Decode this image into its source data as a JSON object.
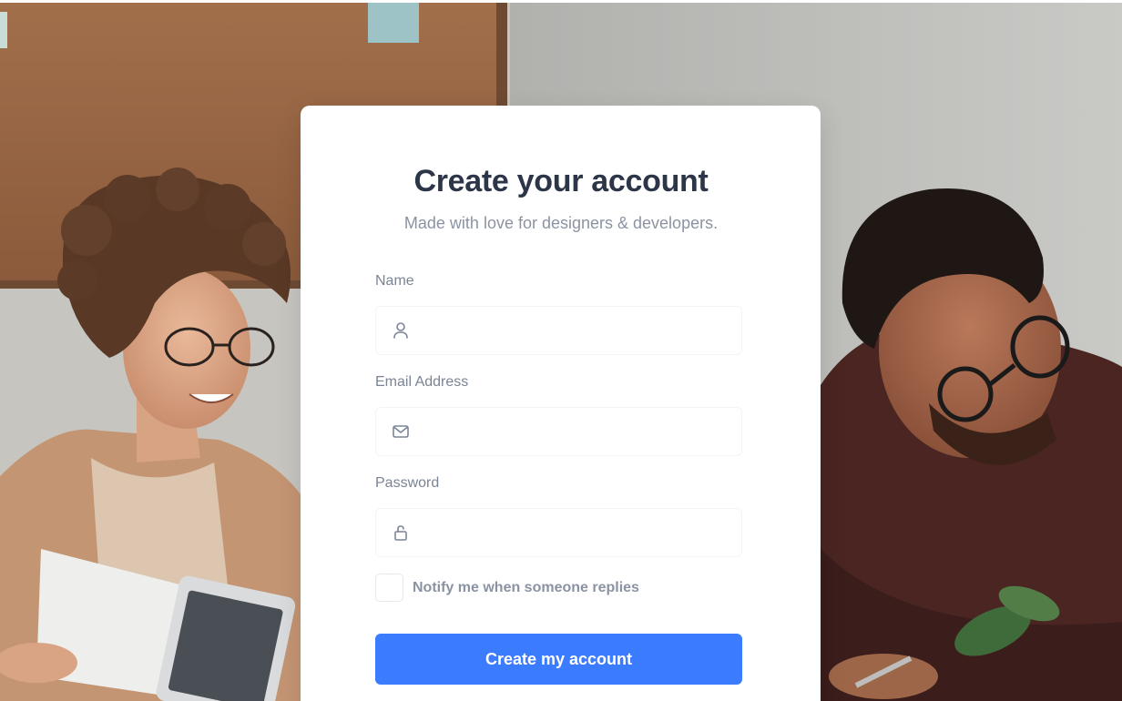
{
  "form": {
    "title": "Create your account",
    "subtitle": "Made with love for designers & developers.",
    "name_label": "Name",
    "name_value": "",
    "email_label": "Email Address",
    "email_value": "",
    "password_label": "Password",
    "password_value": "",
    "notify_label": "Notify me when someone replies",
    "notify_checked": false,
    "submit_label": "Create my account"
  },
  "icons": {
    "name": "user-icon",
    "email": "mail-icon",
    "password": "lock-icon"
  },
  "colors": {
    "accent": "#3b7cff",
    "title": "#2c3648",
    "muted": "#8b93a3"
  }
}
